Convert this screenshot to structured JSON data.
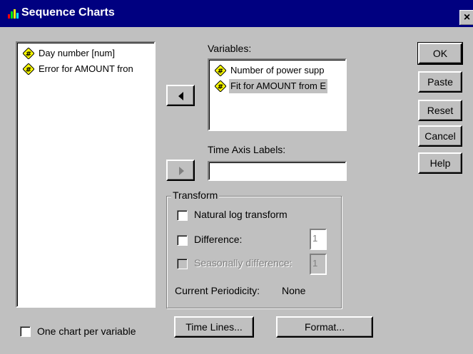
{
  "window": {
    "title": "Sequence Charts",
    "close_label": "×"
  },
  "source_list": {
    "items": [
      {
        "label": "Day number [num]",
        "icon": "numeric-variable-icon"
      },
      {
        "label": "Error for AMOUNT fron",
        "icon": "numeric-variable-icon"
      }
    ]
  },
  "variables": {
    "label": "Variables:",
    "items": [
      {
        "label": "Number of power supp",
        "icon": "numeric-variable-icon"
      },
      {
        "label": "Fit for AMOUNT from E",
        "icon": "numeric-variable-icon"
      }
    ]
  },
  "time_axis": {
    "label": "Time Axis Labels:",
    "value": ""
  },
  "transform": {
    "group_label": "Transform",
    "natural_log_label": "Natural log transform",
    "natural_log_checked": false,
    "difference_label": "Difference:",
    "difference_checked": false,
    "difference_value": "1",
    "seasonal_label": "Seasonally difference:",
    "seasonal_checked": false,
    "seasonal_value": "1",
    "periodicity_label": "Current Periodicity:",
    "periodicity_value": "None"
  },
  "buttons": {
    "ok": "OK",
    "paste": "Paste",
    "reset": "Reset",
    "cancel": "Cancel",
    "help": "Help",
    "time_lines": "Time Lines...",
    "format": "Format..."
  },
  "options": {
    "one_chart_label": "One chart per variable",
    "one_chart_checked": false
  },
  "colors": {
    "title_bar": "#000080",
    "face": "#c0c0c0",
    "icon_yellow": "#ffff00"
  }
}
